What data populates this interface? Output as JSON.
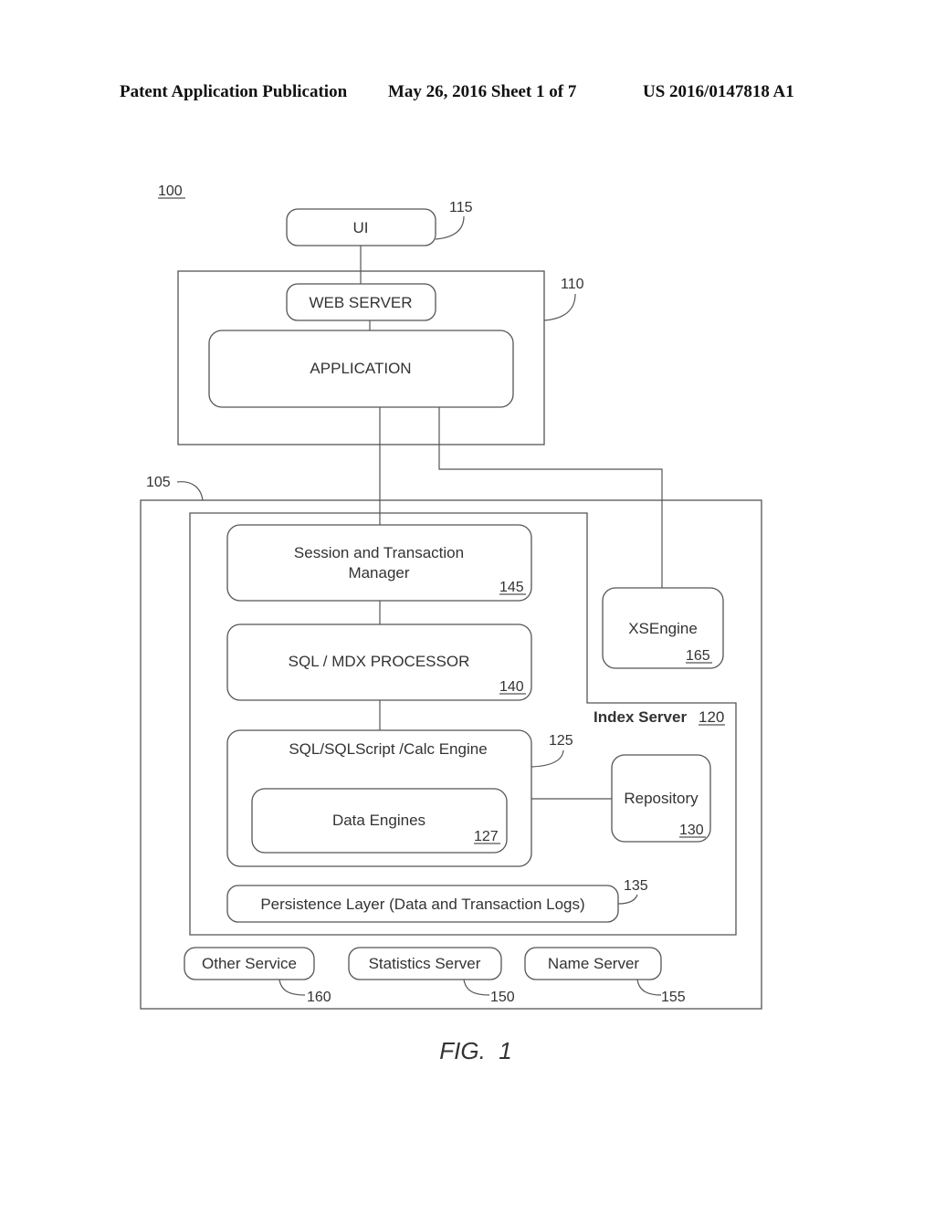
{
  "header": {
    "publication": "Patent Application Publication",
    "date_sheet": "May 26, 2016  Sheet 1 of 7",
    "number": "US 2016/0147818 A1"
  },
  "diagram": {
    "system_ref": "100",
    "ui": {
      "label": "UI",
      "ref": "115"
    },
    "app_server_ref": "110",
    "web_server": {
      "label": "WEB SERVER"
    },
    "application": {
      "label": "APPLICATION"
    },
    "db_system_ref": "105",
    "session_manager": {
      "label_line1": "Session and Transaction",
      "label_line2": "Manager",
      "ref": "145"
    },
    "sql_processor": {
      "label": "SQL / MDX PROCESSOR",
      "ref": "140"
    },
    "xsengine": {
      "label": "XSEngine",
      "ref": "165"
    },
    "index_server": {
      "label": "Index Server",
      "ref": "120"
    },
    "calc_engine": {
      "label": "SQL/SQLScript /Calc Engine",
      "ref": "125"
    },
    "data_engines": {
      "label": "Data Engines",
      "ref": "127"
    },
    "repository": {
      "label": "Repository",
      "ref": "130"
    },
    "persistence": {
      "label": "Persistence Layer (Data and Transaction Logs)",
      "ref": "135"
    },
    "other_service": {
      "label": "Other Service",
      "ref": "160"
    },
    "statistics_server": {
      "label": "Statistics Server",
      "ref": "150"
    },
    "name_server": {
      "label": "Name  Server",
      "ref": "155"
    }
  },
  "caption": "FIG.  1"
}
